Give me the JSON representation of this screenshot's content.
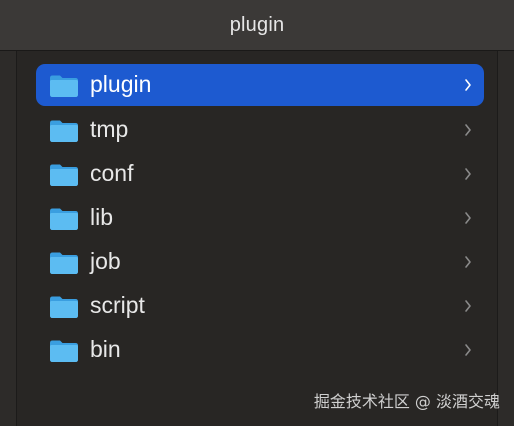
{
  "window": {
    "title": "plugin"
  },
  "list": {
    "items": [
      {
        "label": "plugin",
        "selected": true,
        "icon": "folder-icon"
      },
      {
        "label": "tmp",
        "selected": false,
        "icon": "folder-icon"
      },
      {
        "label": "conf",
        "selected": false,
        "icon": "folder-icon"
      },
      {
        "label": "lib",
        "selected": false,
        "icon": "folder-icon"
      },
      {
        "label": "job",
        "selected": false,
        "icon": "folder-icon"
      },
      {
        "label": "script",
        "selected": false,
        "icon": "folder-icon"
      },
      {
        "label": "bin",
        "selected": false,
        "icon": "folder-icon"
      }
    ]
  },
  "watermark": "掘金技术社区 @ 淡酒交魂",
  "colors": {
    "selection": "#1d5ad0",
    "folder": "#4ab0ea",
    "background": "#282624",
    "titlebar": "#3b3937"
  }
}
